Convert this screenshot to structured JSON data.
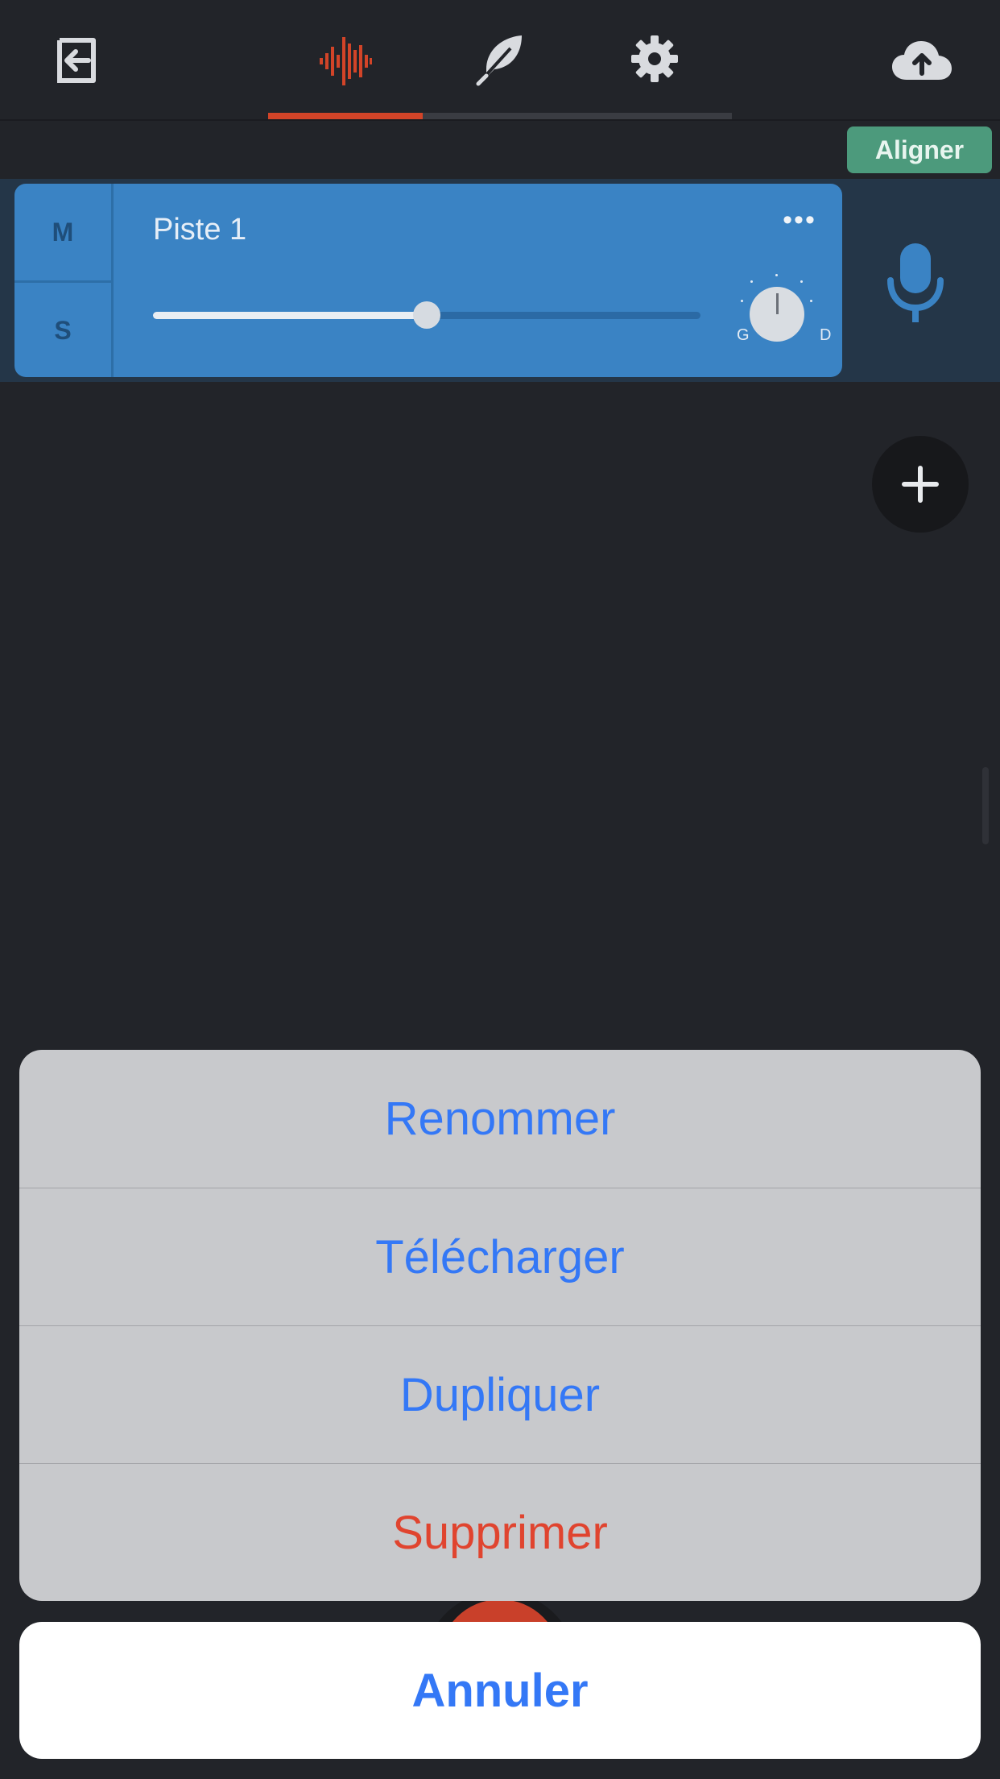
{
  "toolbar": {
    "icons": [
      "exit-icon",
      "waveform-icon",
      "feather-icon",
      "gear-icon",
      "cloud-upload-icon"
    ],
    "active_tab": "waveform",
    "accent_color": "#d24428"
  },
  "subbar": {
    "align_label": "Aligner"
  },
  "track": {
    "name": "Piste 1",
    "mute_label": "M",
    "solo_label": "S",
    "more_label": "•••",
    "volume_level": 0.5,
    "pan_left_label": "G",
    "pan_right_label": "D",
    "color": "#3a83c4"
  },
  "action_sheet": {
    "items": [
      {
        "label": "Renommer"
      },
      {
        "label": "Télécharger"
      },
      {
        "label": "Dupliquer"
      },
      {
        "label": "Supprimer",
        "destructive": true
      }
    ],
    "cancel_label": "Annuler"
  }
}
